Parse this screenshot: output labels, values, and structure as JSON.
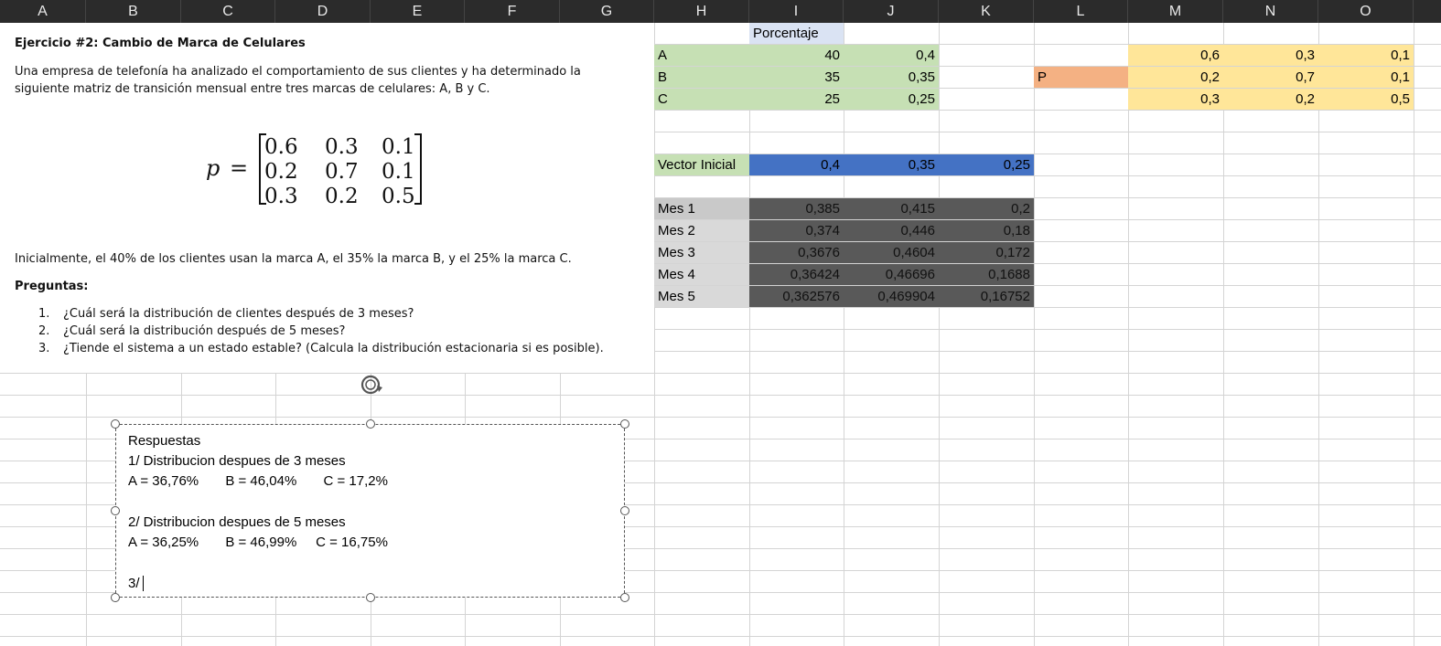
{
  "columns": [
    "A",
    "B",
    "C",
    "D",
    "E",
    "F",
    "G",
    "H",
    "I",
    "J",
    "K",
    "L",
    "M",
    "N",
    "O"
  ],
  "exercise": {
    "title": "Ejercicio #2: Cambio de Marca de Celulares",
    "intro": "Una empresa de telefonía ha analizado el comportamiento de sus clientes y ha determinado la siguiente matriz de transición mensual entre tres marcas de celulares: A, B y C.",
    "matrix_symbol": "p",
    "matrix_equals": "=",
    "matrix": [
      [
        "0.6",
        "0.3",
        "0.1"
      ],
      [
        "0.2",
        "0.7",
        "0.1"
      ],
      [
        "0.3",
        "0.2",
        "0.5"
      ]
    ],
    "initial": "Inicialmente, el 40% de los clientes usan la marca A, el 35% la marca B, y el 25% la marca C.",
    "questions_title": "Preguntas:",
    "questions": [
      {
        "num": "1.",
        "text": "¿Cuál será la distribución de clientes después de 3 meses?"
      },
      {
        "num": "2.",
        "text": "¿Cuál será la distribución después de 5 meses?"
      },
      {
        "num": "3.",
        "text": "¿Tiende el sistema a un estado estable? (Calcula la distribución estacionaria si es posible)."
      }
    ]
  },
  "sheet": {
    "porcentaje_header": "Porcentaje",
    "brands": [
      {
        "label": "A",
        "count": "40",
        "pct": "0,4"
      },
      {
        "label": "B",
        "count": "35",
        "pct": "0,35"
      },
      {
        "label": "C",
        "count": "25",
        "pct": "0,25"
      }
    ],
    "p_label": "P",
    "p_matrix": [
      [
        "0,6",
        "0,3",
        "0,1"
      ],
      [
        "0,2",
        "0,7",
        "0,1"
      ],
      [
        "0,3",
        "0,2",
        "0,5"
      ]
    ],
    "vector_label": "Vector Inicial",
    "vector": [
      "0,4",
      "0,35",
      "0,25"
    ],
    "months": [
      {
        "label": "Mes 1",
        "values": [
          "0,385",
          "0,415",
          "0,2"
        ]
      },
      {
        "label": "Mes 2",
        "values": [
          "0,374",
          "0,446",
          "0,18"
        ]
      },
      {
        "label": "Mes 3",
        "values": [
          "0,3676",
          "0,4604",
          "0,172"
        ]
      },
      {
        "label": "Mes 4",
        "values": [
          "0,36424",
          "0,46696",
          "0,1688"
        ]
      },
      {
        "label": "Mes 5",
        "values": [
          "0,362576",
          "0,469904",
          "0,16752"
        ]
      }
    ]
  },
  "textbox": {
    "lines": [
      "Respuestas",
      "1/ Distribucion despues de 3 meses",
      "A = 36,76%       B = 46,04%       C = 17,2%",
      "",
      "2/ Distribucion despues de 5 meses",
      "A = 36,25%       B = 46,99%     C = 16,75%",
      "",
      "3/"
    ]
  },
  "colors": {
    "header_bg": "#2b2b2b",
    "green": "#c6e0b4",
    "yellow": "#ffe699",
    "orange": "#f4b183",
    "blue": "#4472c4",
    "grey": "#d9d9d9",
    "dark": "#595959"
  }
}
